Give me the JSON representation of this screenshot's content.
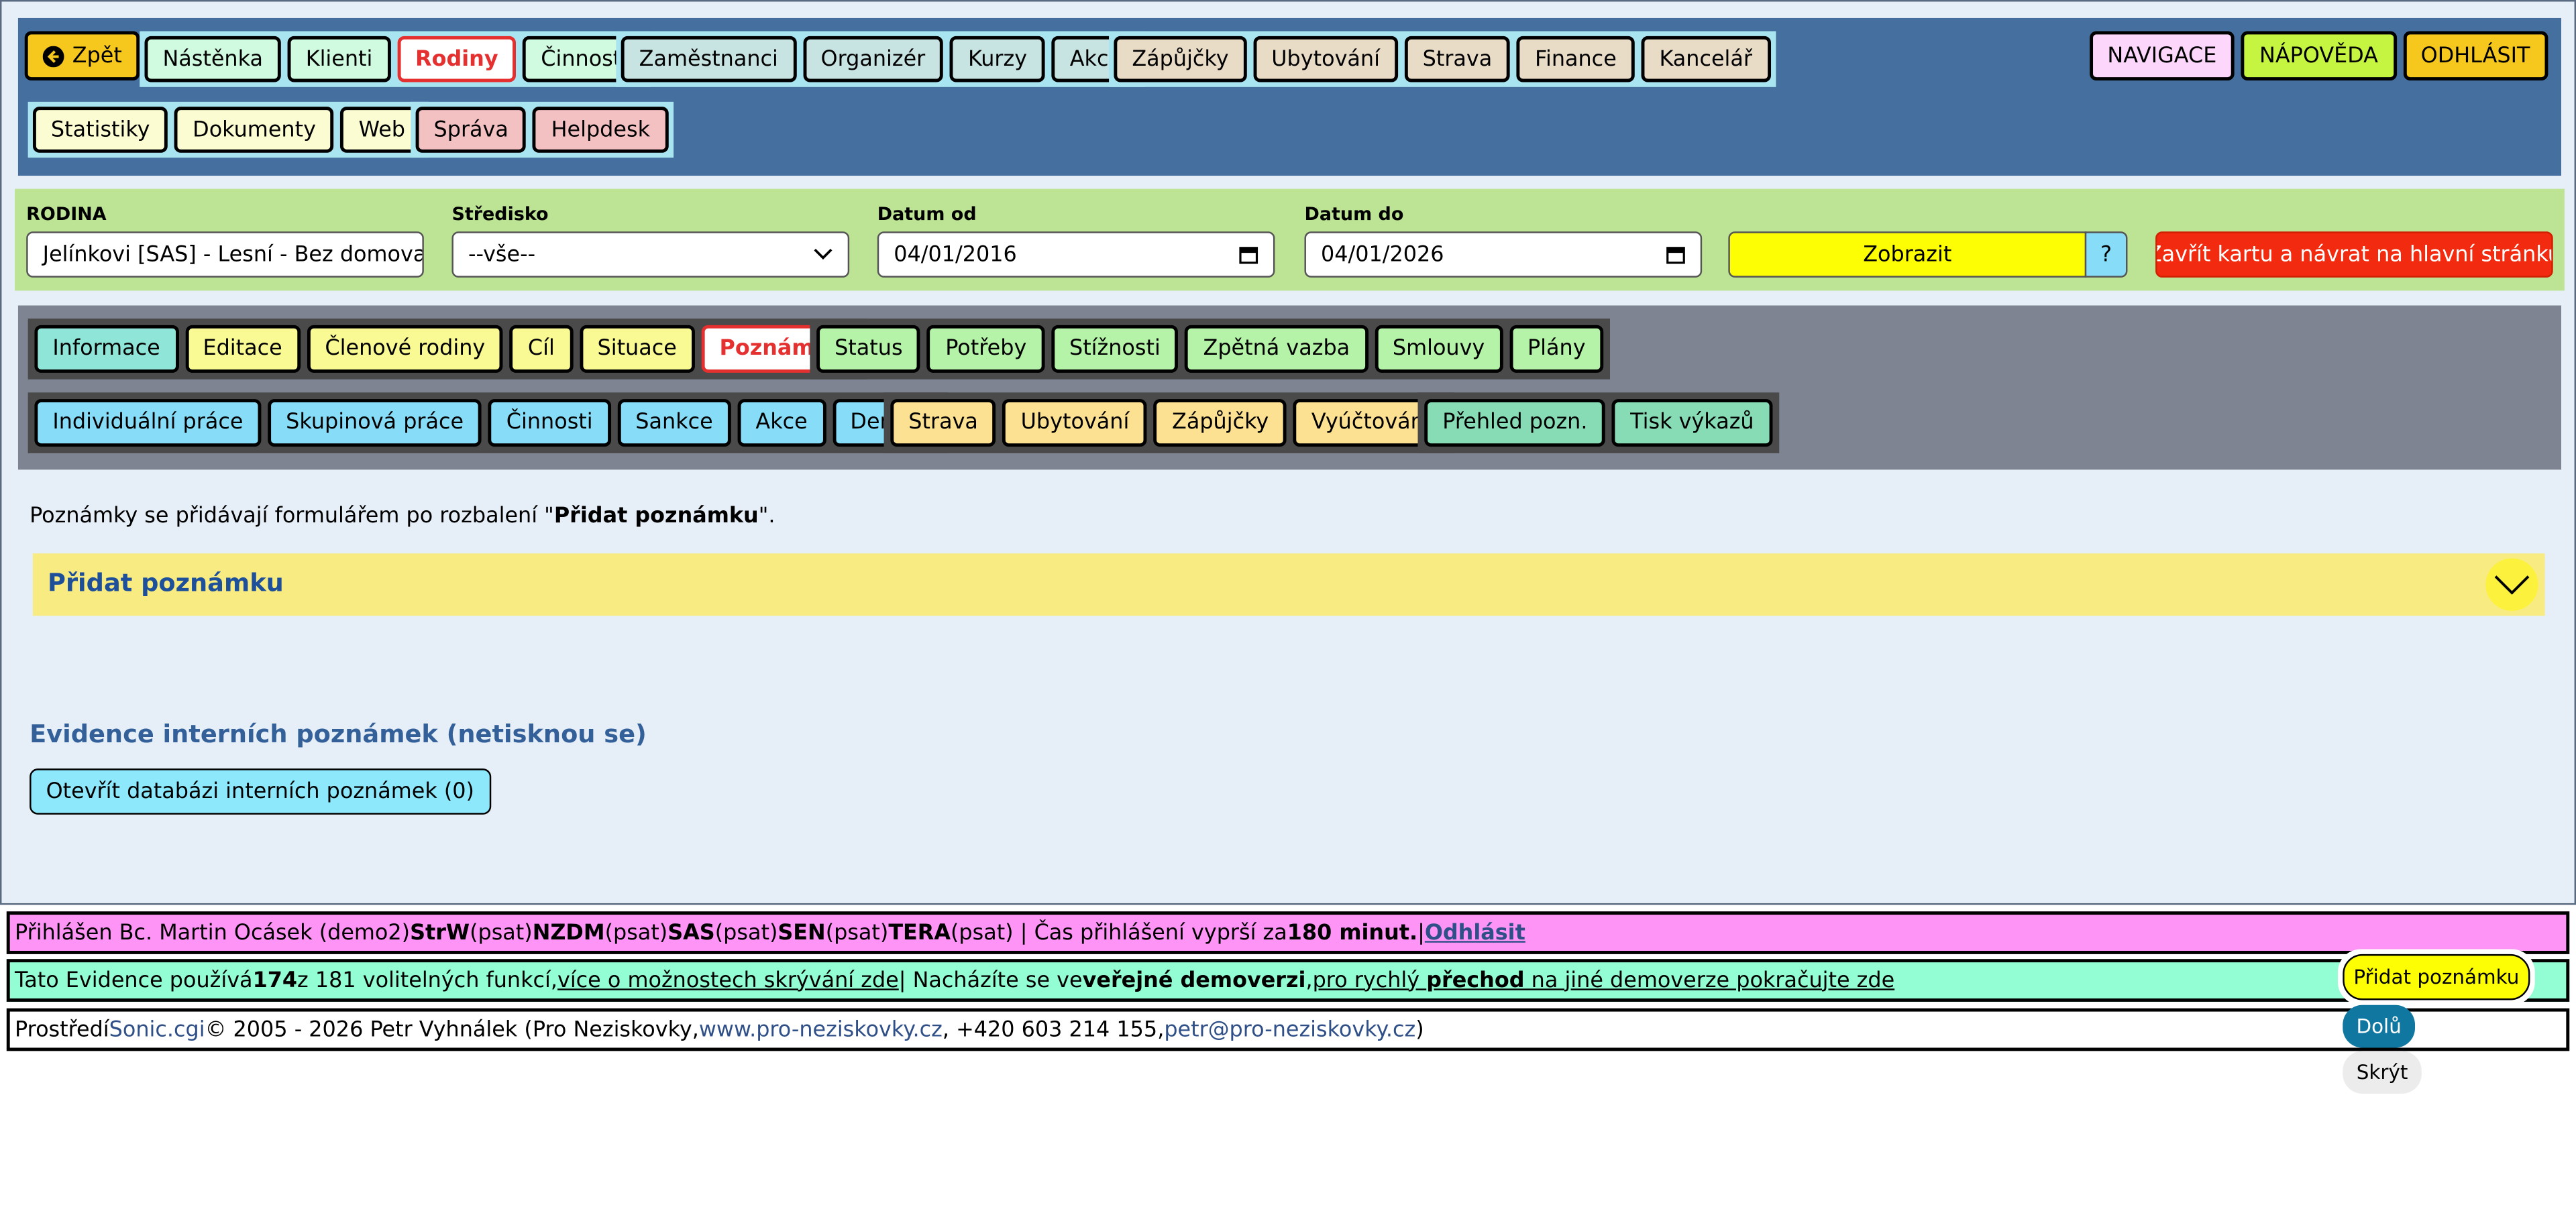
{
  "nav": {
    "back_label": "Zpět",
    "group1": [
      "Nástěnka",
      "Klienti",
      "Rodiny",
      "Činnosti"
    ],
    "group2": [
      "Zaměstnanci",
      "Organizér",
      "Kurzy",
      "Akce"
    ],
    "group3": [
      "Zápůjčky",
      "Ubytování",
      "Strava",
      "Finance",
      "Kancelář"
    ],
    "group4": [
      "Statistiky",
      "Dokumenty",
      "Web"
    ],
    "group5": [
      "Správa",
      "Helpdesk"
    ],
    "right": [
      "NAVIGACE",
      "NÁPOVĚDA",
      "ODHLÁSIT"
    ]
  },
  "filter": {
    "family_label": "RODINA",
    "family_value": "Jelínkovi [SAS] - Lesní - Bez domova",
    "center_label": "Středisko",
    "center_value": "--vše--",
    "from_label": "Datum od",
    "from_value": "04/01/2016",
    "to_label": "Datum do",
    "to_value": "04/01/2026",
    "show_label": "Zobrazit",
    "help_label": "?",
    "close_label": "Zavřít kartu a návrat na hlavní stránku"
  },
  "tabs": {
    "group1": [
      "Informace",
      "Editace",
      "Členové rodiny",
      "Cíl",
      "Situace",
      "Poznámky"
    ],
    "group2": [
      "Status",
      "Potřeby",
      "Stížnosti",
      "Zpětná vazba",
      "Smlouvy",
      "Plány"
    ],
    "group3": [
      "Individuální práce",
      "Skupinová práce",
      "Činnosti",
      "Sankce",
      "Akce",
      "Deníky"
    ],
    "group4": [
      "Strava",
      "Ubytování",
      "Zápůjčky",
      "Vyúčtování"
    ],
    "group5": [
      "Přehled pozn.",
      "Tisk výkazů"
    ]
  },
  "content": {
    "intro_prefix": "Poznámky se přidávají formulářem po rozbalení \"",
    "intro_bold": "Přidat poznámku",
    "intro_suffix": "\".",
    "accordion_title": "Přidat poznámku",
    "section_title": "Evidence interních poznámek (netisknou se)",
    "db_button": "Otevřít databázi interních poznámek  (0)"
  },
  "footer": {
    "login": {
      "prefix": "Přihlášen Bc. Martin Ocásek (demo2) ",
      "o1": "StrW",
      "p1": " (psat) ",
      "o2": "NZDM",
      "p2": " (psat) ",
      "o3": "SAS",
      "p3": " (psat) ",
      "o4": "SEN",
      "p4": " (psat) ",
      "o5": "TERA",
      "p5": " (psat)  |  Čas přihlášení vyprší za ",
      "minutes": "180 minut.",
      "sep": "  |  ",
      "logout": "Odhlásit"
    },
    "features": {
      "prefix": "Tato Evidence používá ",
      "count": "174",
      "mid": " z 181 volitelných funkcí, ",
      "link1": "více o možnostech skrývání zde",
      "mid2": "  |  Nacházíte se ve ",
      "bold": "veřejné demoverzi",
      "comma": ", ",
      "link2a": "pro rychlý ",
      "link2b": "přechod",
      "link2c": " na jiné demoverze pokračujte zde"
    },
    "copyright": {
      "prefix": "Prostředí ",
      "sonic": "Sonic.cgi",
      "mid": " © 2005 - 2026 Petr Vyhnálek (Pro Neziskovky, ",
      "web": "www.pro-neziskovky.cz",
      "mid2": ", +420 603 214 155, ",
      "email": "petr@pro-neziskovky.cz",
      "suffix": ")"
    }
  },
  "floating": {
    "add_label": "Přidat poznámku",
    "down_label": "Dolů",
    "hide_label": "Skrýt"
  },
  "colors": {
    "nav_bg": "#456f9e",
    "filter_bg": "#bde395",
    "tabs_bg": "#7f8493",
    "active_border": "#e53030",
    "login_bar": "#fd94f6",
    "features_bar": "#93fed3"
  }
}
